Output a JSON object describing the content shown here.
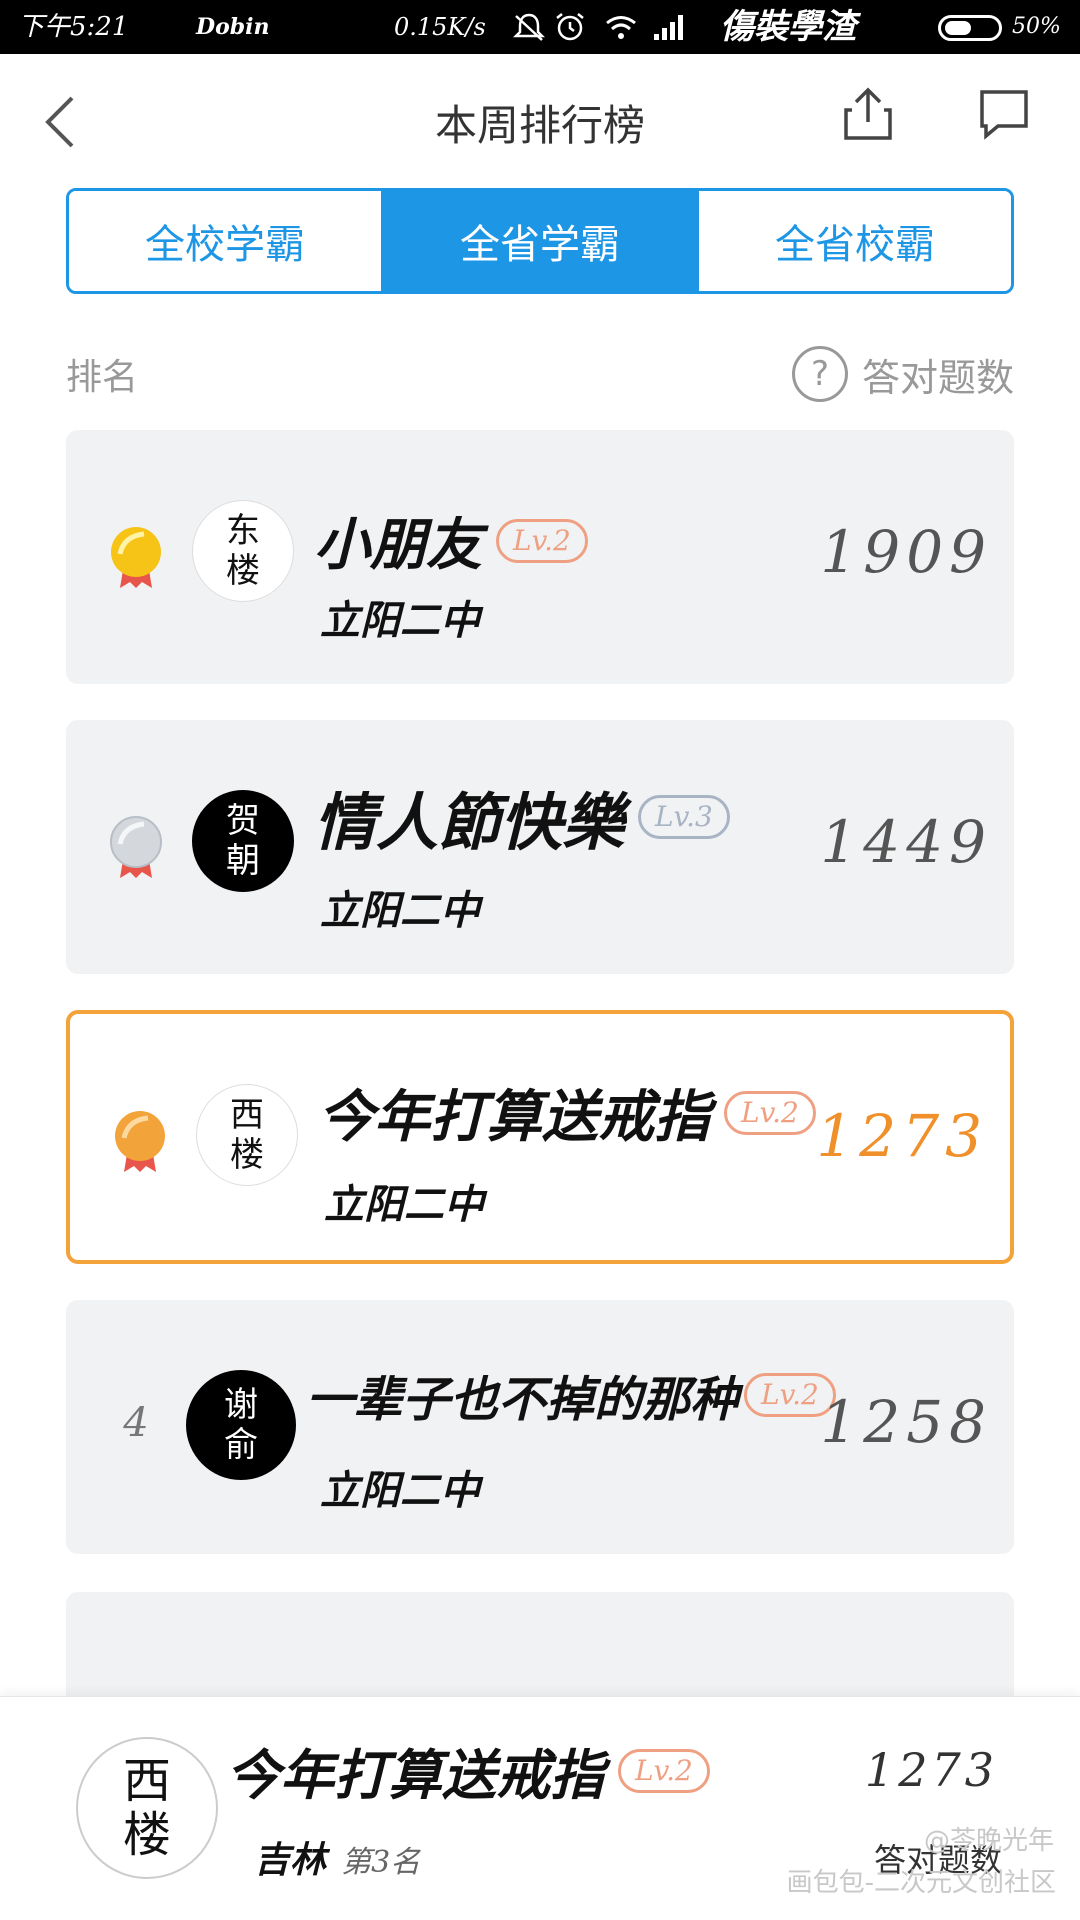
{
  "status_bar": {
    "time": "下午5:21",
    "carrier": "Dobin",
    "speed": "0.15K/s",
    "name_text": "傷裝學渣",
    "battery": "50%",
    "battery_level": 0.5
  },
  "header": {
    "title": "本周排行榜"
  },
  "tabs": [
    {
      "label": "全校学霸",
      "active": false
    },
    {
      "label": "全省学霸",
      "active": true
    },
    {
      "label": "全省校霸",
      "active": false
    }
  ],
  "columns": {
    "rank": "排名",
    "help": "?",
    "count": "答对题数"
  },
  "entries": [
    {
      "rank": 1,
      "medal": "gold",
      "avatar": [
        "东",
        "楼"
      ],
      "avatar_style": "light",
      "name": "小朋友",
      "level": "Lv.2",
      "level_color": "orange",
      "school": "立阳二中",
      "score": "1909",
      "highlight": false
    },
    {
      "rank": 2,
      "medal": "silver",
      "avatar": [
        "贺",
        "朝"
      ],
      "avatar_style": "dark",
      "name": "情人節快樂",
      "level": "Lv.3",
      "level_color": "gray",
      "school": "立阳二中",
      "score": "1449",
      "highlight": false
    },
    {
      "rank": 3,
      "medal": "bronze",
      "avatar": [
        "西",
        "楼"
      ],
      "avatar_style": "light",
      "name": "今年打算送戒指",
      "level": "Lv.2",
      "level_color": "orange",
      "school": "立阳二中",
      "score": "1273",
      "highlight": true
    },
    {
      "rank": "4",
      "medal": "none",
      "avatar": [
        "谢",
        "俞"
      ],
      "avatar_style": "dark",
      "name": "一辈子也不掉的那种",
      "level": "Lv.2",
      "level_color": "orange",
      "school": "立阳二中",
      "score": "1258",
      "highlight": false
    }
  ],
  "self": {
    "avatar": [
      "西",
      "楼"
    ],
    "name": "今年打算送戒指",
    "level": "Lv.2",
    "province": "吉林",
    "rank_text": "第3名",
    "score": "1273",
    "score_label": "答对题数"
  },
  "watermarks": {
    "line1": "@苓晚光年",
    "line2": "画包包-二次元文创社区"
  },
  "colors": {
    "accent": "#1e96e6",
    "highlight_border": "#f4a33b",
    "level_orange": "#f0a082",
    "level_gray": "#a8b4c4"
  }
}
